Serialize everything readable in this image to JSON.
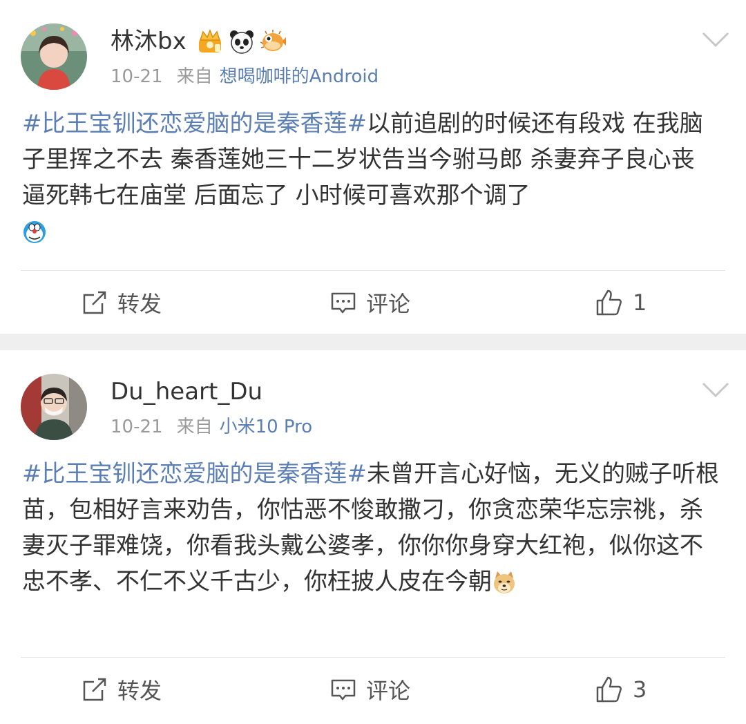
{
  "posts": [
    {
      "username": "林沐bx",
      "date": "10-21",
      "from_label": "来自",
      "source": "想喝咖啡的Android",
      "topic": "#比王宝钏还恋爱脑的是秦香莲#",
      "text": "以前追剧的时候还有段戏 在我脑子里挥之不去 秦香莲她三十二岁状告当今驸马郎 杀妻弃子良心丧 逼死韩七在庙堂 后面忘了 小时候可喜欢那个调了",
      "badges": [
        "vip-crown-icon",
        "panda-icon",
        "pufferfish-icon"
      ],
      "inline_emoji": "doraemon-emoji",
      "actions": {
        "repost": "转发",
        "comment": "评论",
        "like_count": "1"
      }
    },
    {
      "username": "Du_heart_Du",
      "date": "10-21",
      "from_label": "来自",
      "source": "小米10 Pro",
      "topic": "#比王宝钏还恋爱脑的是秦香莲#",
      "text": "未曾开言心好恼，无义的贼子听根苗，包相好言来劝告，你怙恶不悛敢撒刁，你贪恋荣华忘宗祧，杀妻灭子罪难饶，你看我头戴公婆孝，你你你身穿大红袍，似你这不忠不孝、不仁不义千古少，你枉披人皮在今朝",
      "inline_emoji": "doge-emoji",
      "actions": {
        "repost": "转发",
        "comment": "评论",
        "like_count": "3"
      }
    }
  ],
  "colors": {
    "link": "#5b7fb4",
    "text": "#333333",
    "meta": "#9a9a9a",
    "separator": "#efefef"
  }
}
